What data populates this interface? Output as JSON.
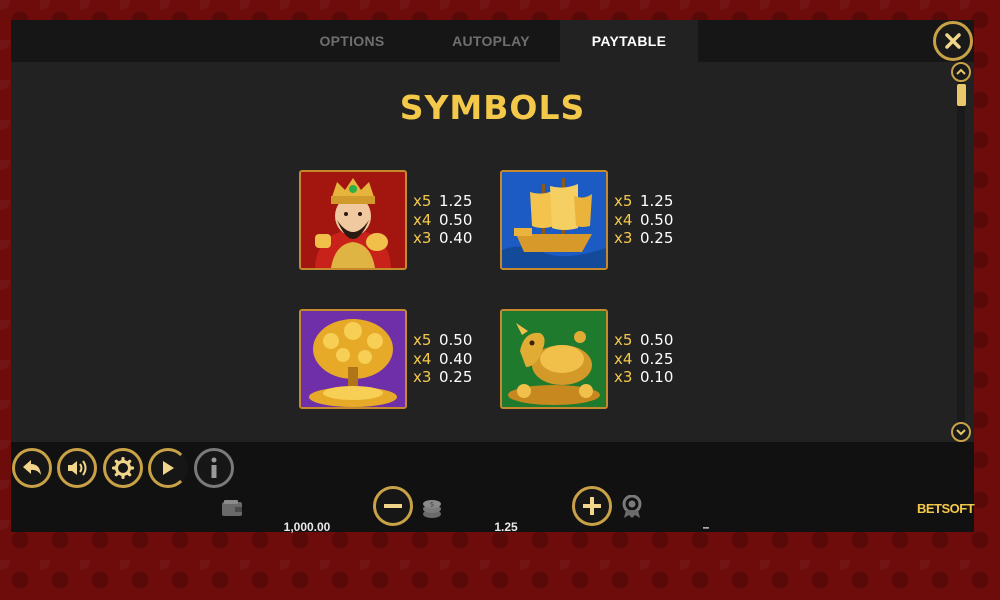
{
  "tabs": {
    "options": "OPTIONS",
    "autoplay": "AUTOPLAY",
    "paytable": "PAYTABLE"
  },
  "paytable": {
    "title": "SYMBOLS",
    "symbols": [
      {
        "name": "fortune-god",
        "pays": [
          {
            "mult": "x5",
            "value": "1.25"
          },
          {
            "mult": "x4",
            "value": "0.50"
          },
          {
            "mult": "x3",
            "value": "0.40"
          }
        ]
      },
      {
        "name": "golden-ship",
        "pays": [
          {
            "mult": "x5",
            "value": "1.25"
          },
          {
            "mult": "x4",
            "value": "0.50"
          },
          {
            "mult": "x3",
            "value": "0.25"
          }
        ]
      },
      {
        "name": "money-tree",
        "pays": [
          {
            "mult": "x5",
            "value": "0.50"
          },
          {
            "mult": "x4",
            "value": "0.40"
          },
          {
            "mult": "x3",
            "value": "0.25"
          }
        ]
      },
      {
        "name": "dragon-turtle",
        "pays": [
          {
            "mult": "x5",
            "value": "0.50"
          },
          {
            "mult": "x4",
            "value": "0.25"
          },
          {
            "mult": "x3",
            "value": "0.10"
          }
        ]
      }
    ]
  },
  "status": {
    "balance": "1,000.00",
    "bet": "1.25",
    "win": "–"
  },
  "brand": "BETSOFT",
  "colors": {
    "accent_gold": "#f4c94a",
    "button_gold": "#c9a247",
    "panel_bg": "#222222",
    "page_bg": "#6e0b0b"
  },
  "icons": [
    "close-icon",
    "back-icon",
    "sound-icon",
    "settings-icon",
    "autoplay-icon",
    "info-icon",
    "wallet-icon",
    "minus-icon",
    "coins-icon",
    "plus-icon",
    "award-icon",
    "scroll-up-icon",
    "scroll-down-icon"
  ]
}
